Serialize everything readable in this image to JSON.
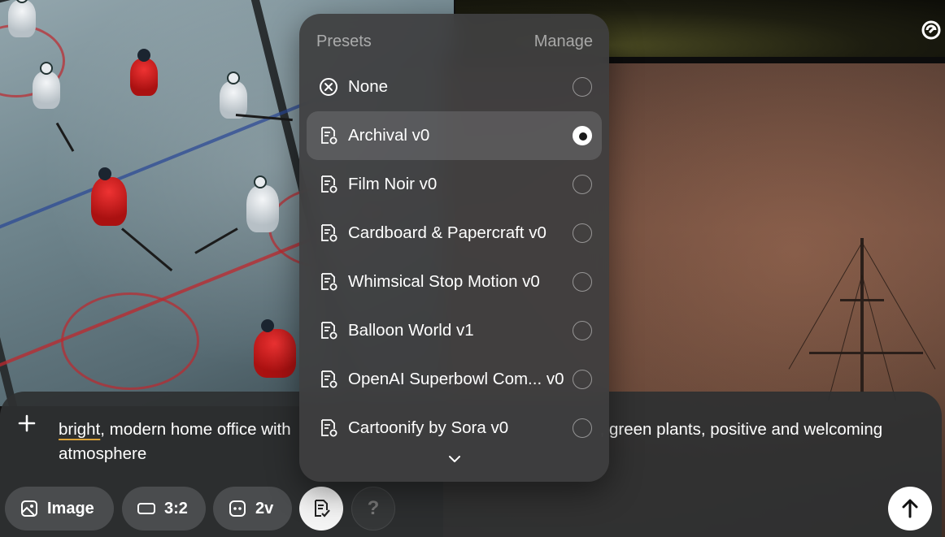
{
  "presets_menu": {
    "title": "Presets",
    "manage_label": "Manage",
    "items": [
      {
        "label": "None",
        "icon": "circle-x-icon",
        "selected": false
      },
      {
        "label": "Archival v0",
        "icon": "preset-icon",
        "selected": true
      },
      {
        "label": "Film Noir v0",
        "icon": "preset-icon",
        "selected": false
      },
      {
        "label": "Cardboard & Papercraft v0",
        "icon": "preset-icon",
        "selected": false
      },
      {
        "label": "Whimsical Stop Motion v0",
        "icon": "preset-icon",
        "selected": false
      },
      {
        "label": "Balloon World v1",
        "icon": "preset-icon",
        "selected": false
      },
      {
        "label": "OpenAI Superbowl Com... v0",
        "icon": "preset-icon",
        "selected": false
      },
      {
        "label": "Cartoonify by Sora v0",
        "icon": "preset-icon",
        "selected": false
      }
    ]
  },
  "composer": {
    "prompt_first_word": "bright",
    "prompt_line1_left": ", modern home office with",
    "prompt_line1_right": ", green plants, positive and welcoming",
    "prompt_line2": "atmosphere",
    "type_label": "Image",
    "aspect_label": "3:2",
    "variations_label": "2v",
    "help_label": "?"
  },
  "colors": {
    "accent_underline": "#d9a23a",
    "popover_bg": "#3e3e40",
    "composer_bg": "#2e3032"
  }
}
